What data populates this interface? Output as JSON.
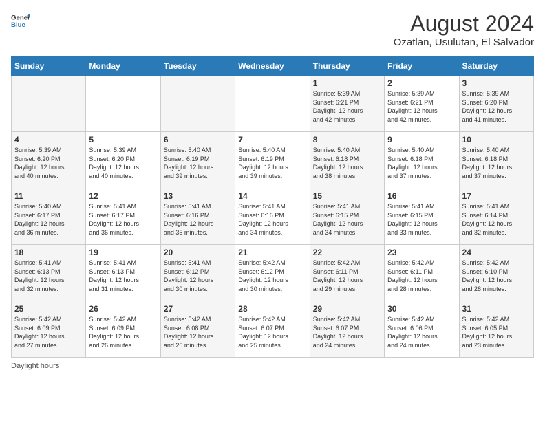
{
  "header": {
    "logo_line1": "General",
    "logo_line2": "Blue",
    "title": "August 2024",
    "subtitle": "Ozatlan, Usulutan, El Salvador"
  },
  "days_of_week": [
    "Sunday",
    "Monday",
    "Tuesday",
    "Wednesday",
    "Thursday",
    "Friday",
    "Saturday"
  ],
  "weeks": [
    [
      {
        "day": "",
        "info": ""
      },
      {
        "day": "",
        "info": ""
      },
      {
        "day": "",
        "info": ""
      },
      {
        "day": "",
        "info": ""
      },
      {
        "day": "1",
        "info": "Sunrise: 5:39 AM\nSunset: 6:21 PM\nDaylight: 12 hours\nand 42 minutes."
      },
      {
        "day": "2",
        "info": "Sunrise: 5:39 AM\nSunset: 6:21 PM\nDaylight: 12 hours\nand 42 minutes."
      },
      {
        "day": "3",
        "info": "Sunrise: 5:39 AM\nSunset: 6:20 PM\nDaylight: 12 hours\nand 41 minutes."
      }
    ],
    [
      {
        "day": "4",
        "info": "Sunrise: 5:39 AM\nSunset: 6:20 PM\nDaylight: 12 hours\nand 40 minutes."
      },
      {
        "day": "5",
        "info": "Sunrise: 5:39 AM\nSunset: 6:20 PM\nDaylight: 12 hours\nand 40 minutes."
      },
      {
        "day": "6",
        "info": "Sunrise: 5:40 AM\nSunset: 6:19 PM\nDaylight: 12 hours\nand 39 minutes."
      },
      {
        "day": "7",
        "info": "Sunrise: 5:40 AM\nSunset: 6:19 PM\nDaylight: 12 hours\nand 39 minutes."
      },
      {
        "day": "8",
        "info": "Sunrise: 5:40 AM\nSunset: 6:18 PM\nDaylight: 12 hours\nand 38 minutes."
      },
      {
        "day": "9",
        "info": "Sunrise: 5:40 AM\nSunset: 6:18 PM\nDaylight: 12 hours\nand 37 minutes."
      },
      {
        "day": "10",
        "info": "Sunrise: 5:40 AM\nSunset: 6:18 PM\nDaylight: 12 hours\nand 37 minutes."
      }
    ],
    [
      {
        "day": "11",
        "info": "Sunrise: 5:40 AM\nSunset: 6:17 PM\nDaylight: 12 hours\nand 36 minutes."
      },
      {
        "day": "12",
        "info": "Sunrise: 5:41 AM\nSunset: 6:17 PM\nDaylight: 12 hours\nand 36 minutes."
      },
      {
        "day": "13",
        "info": "Sunrise: 5:41 AM\nSunset: 6:16 PM\nDaylight: 12 hours\nand 35 minutes."
      },
      {
        "day": "14",
        "info": "Sunrise: 5:41 AM\nSunset: 6:16 PM\nDaylight: 12 hours\nand 34 minutes."
      },
      {
        "day": "15",
        "info": "Sunrise: 5:41 AM\nSunset: 6:15 PM\nDaylight: 12 hours\nand 34 minutes."
      },
      {
        "day": "16",
        "info": "Sunrise: 5:41 AM\nSunset: 6:15 PM\nDaylight: 12 hours\nand 33 minutes."
      },
      {
        "day": "17",
        "info": "Sunrise: 5:41 AM\nSunset: 6:14 PM\nDaylight: 12 hours\nand 32 minutes."
      }
    ],
    [
      {
        "day": "18",
        "info": "Sunrise: 5:41 AM\nSunset: 6:13 PM\nDaylight: 12 hours\nand 32 minutes."
      },
      {
        "day": "19",
        "info": "Sunrise: 5:41 AM\nSunset: 6:13 PM\nDaylight: 12 hours\nand 31 minutes."
      },
      {
        "day": "20",
        "info": "Sunrise: 5:41 AM\nSunset: 6:12 PM\nDaylight: 12 hours\nand 30 minutes."
      },
      {
        "day": "21",
        "info": "Sunrise: 5:42 AM\nSunset: 6:12 PM\nDaylight: 12 hours\nand 30 minutes."
      },
      {
        "day": "22",
        "info": "Sunrise: 5:42 AM\nSunset: 6:11 PM\nDaylight: 12 hours\nand 29 minutes."
      },
      {
        "day": "23",
        "info": "Sunrise: 5:42 AM\nSunset: 6:11 PM\nDaylight: 12 hours\nand 28 minutes."
      },
      {
        "day": "24",
        "info": "Sunrise: 5:42 AM\nSunset: 6:10 PM\nDaylight: 12 hours\nand 28 minutes."
      }
    ],
    [
      {
        "day": "25",
        "info": "Sunrise: 5:42 AM\nSunset: 6:09 PM\nDaylight: 12 hours\nand 27 minutes."
      },
      {
        "day": "26",
        "info": "Sunrise: 5:42 AM\nSunset: 6:09 PM\nDaylight: 12 hours\nand 26 minutes."
      },
      {
        "day": "27",
        "info": "Sunrise: 5:42 AM\nSunset: 6:08 PM\nDaylight: 12 hours\nand 26 minutes."
      },
      {
        "day": "28",
        "info": "Sunrise: 5:42 AM\nSunset: 6:07 PM\nDaylight: 12 hours\nand 25 minutes."
      },
      {
        "day": "29",
        "info": "Sunrise: 5:42 AM\nSunset: 6:07 PM\nDaylight: 12 hours\nand 24 minutes."
      },
      {
        "day": "30",
        "info": "Sunrise: 5:42 AM\nSunset: 6:06 PM\nDaylight: 12 hours\nand 24 minutes."
      },
      {
        "day": "31",
        "info": "Sunrise: 5:42 AM\nSunset: 6:05 PM\nDaylight: 12 hours\nand 23 minutes."
      }
    ]
  ],
  "footer": {
    "daylight_label": "Daylight hours"
  },
  "colors": {
    "header_bg": "#2a7ab8",
    "accent": "#2a7ab8"
  }
}
